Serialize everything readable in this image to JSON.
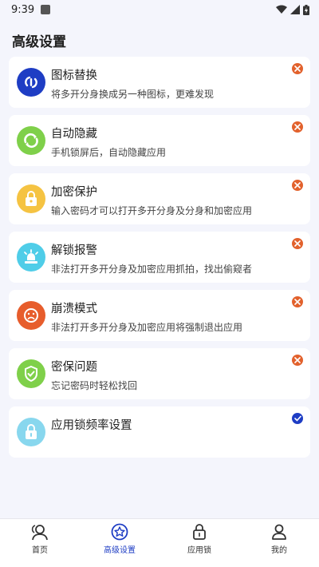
{
  "status": {
    "time": "9:39"
  },
  "page": {
    "title": "高级设置"
  },
  "colors": {
    "accent": "#1e3dc4",
    "close_mark": "#e2612c"
  },
  "settings": [
    {
      "title": "图标替换",
      "desc": "将多开分身换成另一种图标，更难发现",
      "icon": "icon-replace-icon",
      "color": "#1e3dc4",
      "state": "disabled"
    },
    {
      "title": "自动隐藏",
      "desc": "手机锁屏后，自动隐藏应用",
      "icon": "auto-hide-icon",
      "color": "#7fd04a",
      "state": "disabled"
    },
    {
      "title": "加密保护",
      "desc": "输入密码才可以打开多开分身及分身和加密应用",
      "icon": "padlock-icon",
      "color": "#f5c342",
      "state": "disabled"
    },
    {
      "title": "解锁报警",
      "desc": "非法打开多开分身及加密应用抓拍，找出偷窥者",
      "icon": "alarm-light-icon",
      "color": "#4fcde8",
      "state": "disabled"
    },
    {
      "title": "崩溃模式",
      "desc": "非法打开多开分身及加密应用将强制退出应用",
      "icon": "sad-face-icon",
      "color": "#e75d2c",
      "state": "disabled"
    },
    {
      "title": "密保问题",
      "desc": "忘记密码时轻松找回",
      "icon": "shield-check-icon",
      "color": "#7fd04a",
      "state": "disabled"
    },
    {
      "title": "应用锁频率设置",
      "desc": "",
      "icon": "lock-icon",
      "color": "#88d7ee",
      "state": "enabled"
    }
  ],
  "nav": [
    {
      "label": "首页",
      "icon": "users-icon",
      "active": false
    },
    {
      "label": "高级设置",
      "icon": "star-settings-icon",
      "active": true
    },
    {
      "label": "应用锁",
      "icon": "lock-icon",
      "active": false
    },
    {
      "label": "我的",
      "icon": "person-icon",
      "active": false
    }
  ]
}
